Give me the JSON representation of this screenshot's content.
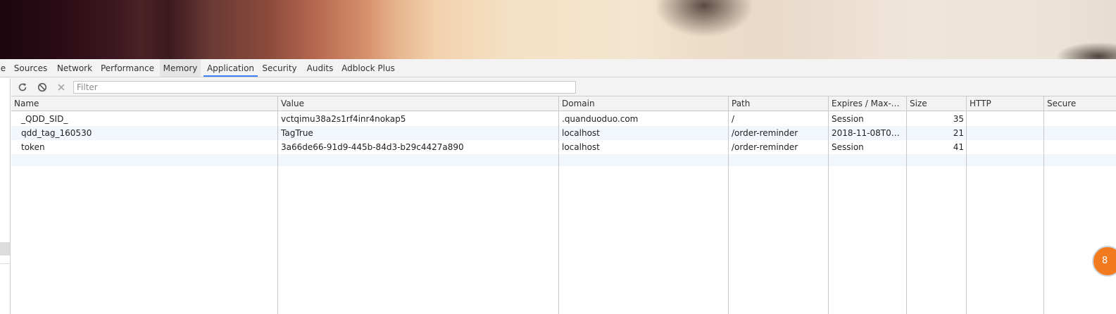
{
  "tabs": [
    "e",
    "Sources",
    "Network",
    "Performance",
    "Memory",
    "Application",
    "Security",
    "Audits",
    "Adblock Plus"
  ],
  "active_tab": "Application",
  "toolbar": {
    "filter_placeholder": "Filter",
    "refresh_icon": "refresh-icon",
    "clear_all_icon": "clear-all-icon",
    "delete_selected_icon": "delete-selected-icon"
  },
  "table": {
    "headers": [
      "Name",
      "Value",
      "Domain",
      "Path",
      "Expires / Max-Age",
      "Size",
      "HTTP",
      "Secure"
    ],
    "rows": [
      [
        "_QDD_SID_",
        "vctqimu38a2s1rf4inr4nokap5",
        ".quanduoduo.com",
        "/",
        "Session",
        "35",
        "",
        ""
      ],
      [
        "qdd_tag_160530",
        "TagTrue",
        "localhost",
        "/order-reminder",
        "2018-11-08T03:3...",
        "21",
        "",
        ""
      ],
      [
        "token",
        "3a66de66-91d9-445b-84d3-b29c4427a890",
        "localhost",
        "/order-reminder",
        "Session",
        "41",
        "",
        ""
      ]
    ]
  },
  "badge_text": "8",
  "colors": {
    "accent": "#3e82f7",
    "badge": "#f27a1f",
    "alt_row": "#f2f7fd"
  }
}
